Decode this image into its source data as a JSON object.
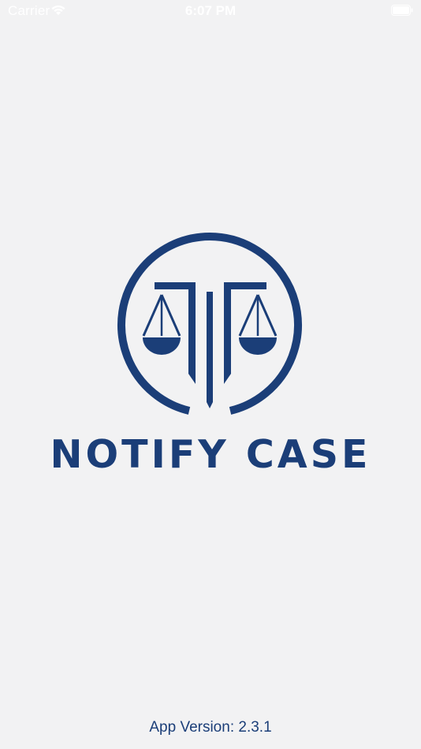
{
  "status_bar": {
    "carrier": "Carrier",
    "time": "6:07 PM",
    "icons": [
      "wifi-icon",
      "battery-icon"
    ]
  },
  "logo": {
    "icon": "scales-of-justice-icon",
    "brand_name": "NOTIFY CASE"
  },
  "footer": {
    "version": "App Version: 2.3.1"
  },
  "colors": {
    "brand": "#1b3e78",
    "background": "#f2f2f3",
    "status_text": "#ffffff"
  }
}
